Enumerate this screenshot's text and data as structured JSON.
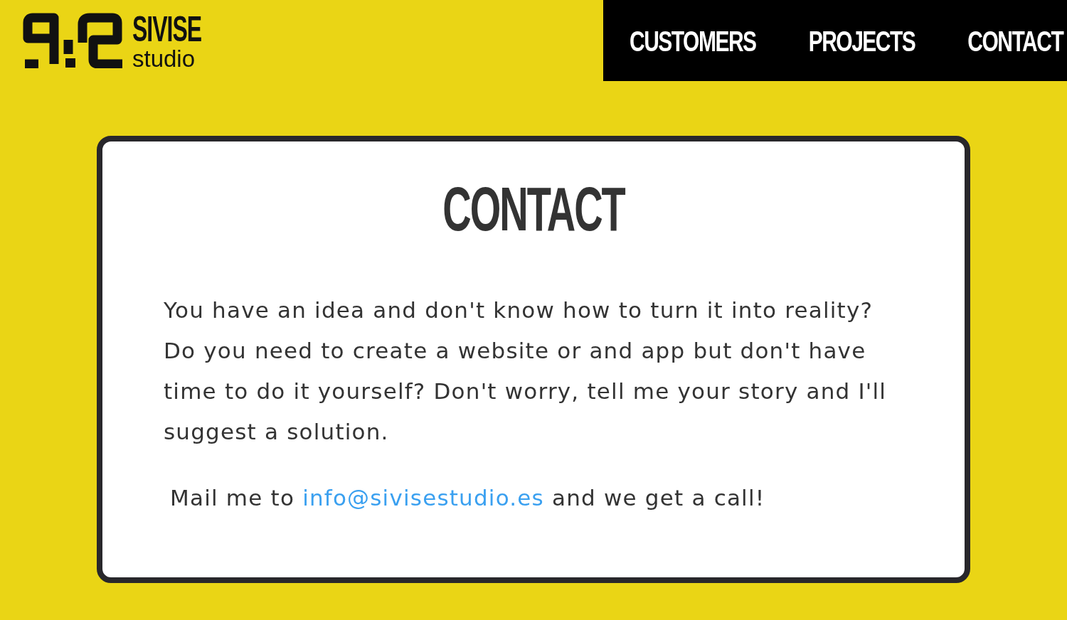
{
  "header": {
    "logo": {
      "wordmark": "SIVISE",
      "tagline": "studio"
    },
    "nav": [
      {
        "label": "CUSTOMERS"
      },
      {
        "label": "PROJECTS"
      },
      {
        "label": "CONTACT"
      }
    ]
  },
  "contact_card": {
    "title": "CONTACT",
    "paragraph": "You have an idea and don't know how to turn it into reality? Do you need to create a website or and app but don't have time to do it yourself? Don't worry, tell me your story and I'll suggest a solution.",
    "mail_line": {
      "before": "Mail me to",
      "link": "info@sivisestudio.es",
      "after": "and we get a call!"
    }
  }
}
